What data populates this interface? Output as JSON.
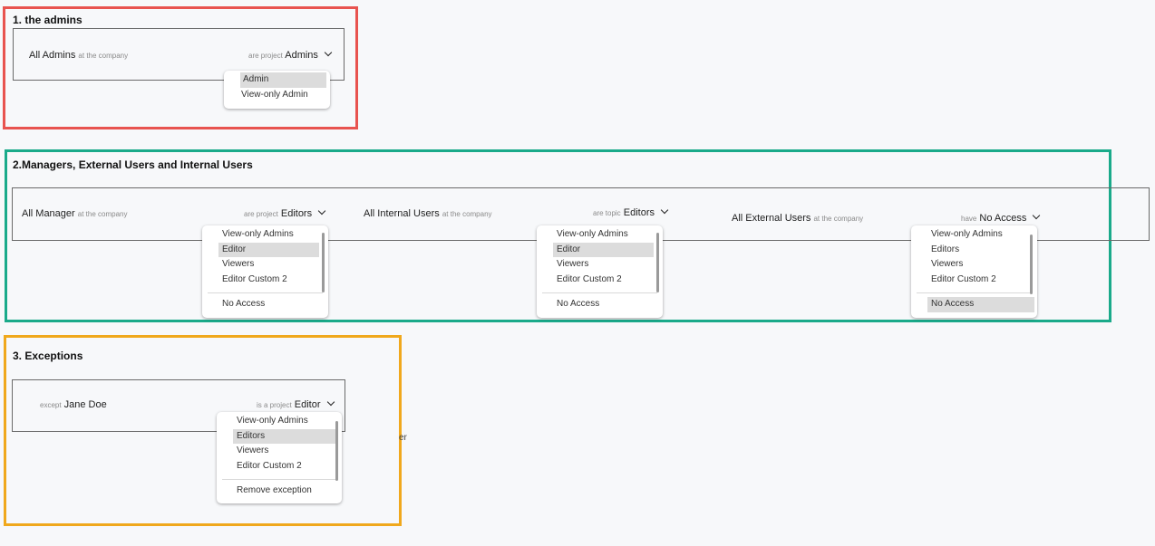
{
  "sections": {
    "admins": {
      "title": "1. the admins",
      "border_color": "#e8534f",
      "rule": {
        "subject": "All Admins",
        "scope": "at the company",
        "verb": "are project",
        "role": "Admins",
        "options": [
          "Admin",
          "View-only Admin"
        ],
        "selected": "Admin"
      }
    },
    "managers": {
      "title": "2.Managers, External Users and Internal Users",
      "border_color": "#1aaa8a",
      "rules": [
        {
          "subject": "All Manager",
          "scope": "at the company",
          "verb": "are project",
          "role": "Editors",
          "options": [
            "View-only Admins",
            "Editor",
            "Viewers",
            "Editor Custom 2"
          ],
          "extra": "No Access",
          "selected": "Editor"
        },
        {
          "subject": "All Internal Users",
          "scope": "at the company",
          "verb": "are topic",
          "role": "Editors",
          "options": [
            "View-only Admins",
            "Editor",
            "Viewers",
            "Editor Custom 2"
          ],
          "extra": "No Access",
          "selected": "Editor"
        },
        {
          "subject": "All External Users",
          "scope": "at the company",
          "verb": "have",
          "role": "No Access",
          "options": [
            "View-only Admins",
            "Editors",
            "Viewers",
            "Editor Custom 2"
          ],
          "extra": "No Access",
          "selected": "No Access"
        }
      ]
    },
    "exceptions": {
      "title": "3. Exceptions",
      "border_color": "#f0a81c",
      "rule": {
        "prefix": "except",
        "subject": "Jane Doe",
        "verb": "is a project",
        "role": "Editor",
        "options": [
          "View-only Admins",
          "Editors",
          "Viewers",
          "Editor Custom 2"
        ],
        "extra": "Remove exception",
        "selected": "Editors"
      },
      "stray_text": "er"
    }
  }
}
